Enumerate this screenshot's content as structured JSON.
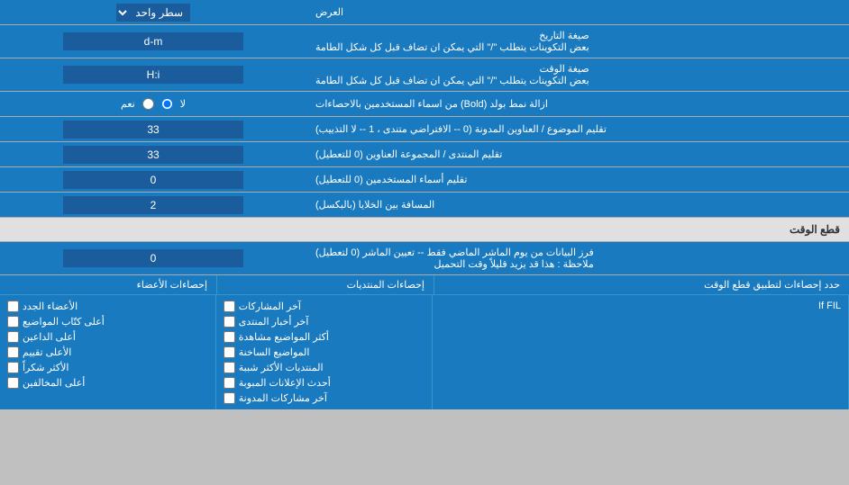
{
  "page": {
    "title": "العرض",
    "rows": [
      {
        "id": "single-line",
        "label": "",
        "input_type": "select",
        "input_value": "سطر واحد",
        "label_text": ""
      },
      {
        "id": "date-format",
        "label": "صيغة التاريخ\nبعض التكوينات يتطلب \"/\" التي يمكن ان تضاف قبل كل شكل الطامة",
        "label_line1": "صيغة التاريخ",
        "label_line2": "بعض التكوينات يتطلب \"/\" التي يمكن ان تضاف قبل كل شكل الطامة",
        "input_type": "text",
        "input_value": "d-m"
      },
      {
        "id": "time-format",
        "label_line1": "صيغة الوقت",
        "label_line2": "بعض التكوينات يتطلب \"/\" التي يمكن ان تضاف قبل كل شكل الطامة",
        "input_type": "text",
        "input_value": "H:i"
      },
      {
        "id": "bold-remove",
        "label": "ازالة نمط بولد (Bold) من اسماء المستخدمين بالاحصاءات",
        "input_type": "radio",
        "radio_yes": "نعم",
        "radio_no": "لا",
        "selected": "no"
      },
      {
        "id": "forum-topics",
        "label": "تقليم الموضوع / العناوين المدونة (0 -- الافتراضي متندى ، 1 -- لا التذييب)",
        "input_type": "text",
        "input_value": "33"
      },
      {
        "id": "forum-group",
        "label": "تقليم المنتدى / المجموعة العناوين (0 للتعطيل)",
        "input_type": "text",
        "input_value": "33"
      },
      {
        "id": "usernames",
        "label": "تقليم أسماء المستخدمين (0 للتعطيل)",
        "input_type": "text",
        "input_value": "0"
      },
      {
        "id": "spacing",
        "label": "المسافة بين الخلايا (بالبكسل)",
        "input_type": "text",
        "input_value": "2"
      }
    ],
    "cutoff_section": {
      "title": "قطع الوقت",
      "row": {
        "id": "cutoff-days",
        "label_line1": "فرز البيانات من يوم الماشر الماضي فقط -- تعيين الماشر (0 لتعطيل)",
        "label_line2": "ملاحظة : هذا قد يزيد قليلاً وقت التحميل",
        "input_value": "0"
      }
    },
    "limit_section": {
      "label": "حدد إحصاءات لتطبيق قطع الوقت"
    },
    "checkboxes": {
      "col1_header": "إحصاءات الأعضاء",
      "col2_header": "إحصاءات المنتديات",
      "col1_items": [
        "الأعضاء الجدد",
        "أعلى كتّاب المواضيع",
        "أعلى الداعين",
        "الأعلى تقييم",
        "الأكثر شكراً",
        "أعلى المخالفين"
      ],
      "col2_items": [
        "آخر المشاركات",
        "آخر أخبار المنتدى",
        "أكثر المواضيع مشاهدة",
        "المواضيع الساخنة",
        "المنتديات الأكثر شببة",
        "أحدث الإعلانات المبوبة",
        "آخر مشاركات المدونة"
      ],
      "col1_label": "إحصاءات الأعضاء",
      "col2_label": "إحصاءات المنتديات",
      "bottom_text": "If FIL"
    }
  }
}
